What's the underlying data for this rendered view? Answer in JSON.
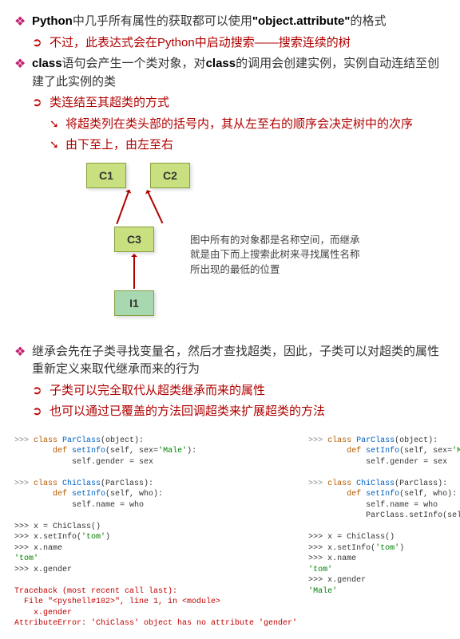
{
  "b1": {
    "t1": "Python",
    "t2": "中几乎所有属性的获取都可以使用",
    "t3": "\"object.attribute\"",
    "t4": "的格式"
  },
  "b1a": "不过，此表达式会在Python中启动搜索——搜索连续的树",
  "b2": {
    "t1": "class",
    "t2": "语句会产生一个类对象，对",
    "t3": "class",
    "t4": "的调用会创建实例，实例自动连结至创建了此实例的类"
  },
  "b2a": "类连结至其超类的方式",
  "b2a1": "将超类列在类头部的括号内，其从左至右的顺序会决定树中的次序",
  "b2a2": "由下至上，由左至右",
  "diag": {
    "c1": "C1",
    "c2": "C2",
    "c3": "C3",
    "i1": "I1",
    "note": "图中所有的对象都是名称空间，而继承就是由下而上搜索此树来寻找属性名称所出现的最低的位置"
  },
  "b3": "继承会先在子类寻找变量名，然后才查找超类，因此，子类可以对超类的属性重新定义来取代继承而来的行为",
  "b3a": "子类可以完全取代从超类继承而来的属性",
  "b3b": "也可以通过已覆盖的方法回调超类来扩展超类的方法",
  "code_left": {
    "l01": ">>> ",
    "l02": "class",
    "l03": " ParClass",
    "l04": "(object):",
    "l05": "        ",
    "l06": "def",
    "l07": " setInfo",
    "l08": "(self, sex=",
    "l09": "'Male'",
    "l10": "):",
    "l11": "            self.gender = sex",
    "l12": ">>> ",
    "l13": "class",
    "l14": " ChiClass",
    "l15": "(ParClass):",
    "l16": "        ",
    "l17": "def",
    "l18": " setInfo",
    "l19": "(self, who):",
    "l20": "            self.name = who",
    "l21": ">>> x = ChiClass()",
    "l22": ">>> x.setInfo(",
    "l23": "'tom'",
    "l24": ")",
    "l25": ">>> x.name",
    "l26": "'tom'",
    "l27": ">>> x.gender",
    "l28": "Traceback (most recent call last):",
    "l29": "  File \"<pyshell#102>\", line 1, in <module>",
    "l30": "    x.gender",
    "l31": "AttributeError: 'ChiClass' object has no attribute 'gender'"
  },
  "code_right": {
    "l01": ">>> ",
    "l02": "class",
    "l03": " ParClass",
    "l04": "(object):",
    "l05": "        ",
    "l06": "def",
    "l07": " setInfo",
    "l08": "(self, sex=",
    "l09": "'Male'",
    "l10": "):",
    "l11": "            self.gender = sex",
    "l12": ">>> ",
    "l13": "class",
    "l14": " ChiClass",
    "l15": "(ParClass):",
    "l16": "        ",
    "l17": "def",
    "l18": " setInfo",
    "l19": "(self, who):",
    "l20": "            self.name = who",
    "l21": "            ParClass.setInfo(self)",
    "l22": ">>> x = ChiClass()",
    "l23": ">>> x.setInfo(",
    "l24": "'tom'",
    "l25": ")",
    "l26": ">>> x.name",
    "l27": "'tom'",
    "l28": ">>> x.gender",
    "l29": "'Male'"
  }
}
